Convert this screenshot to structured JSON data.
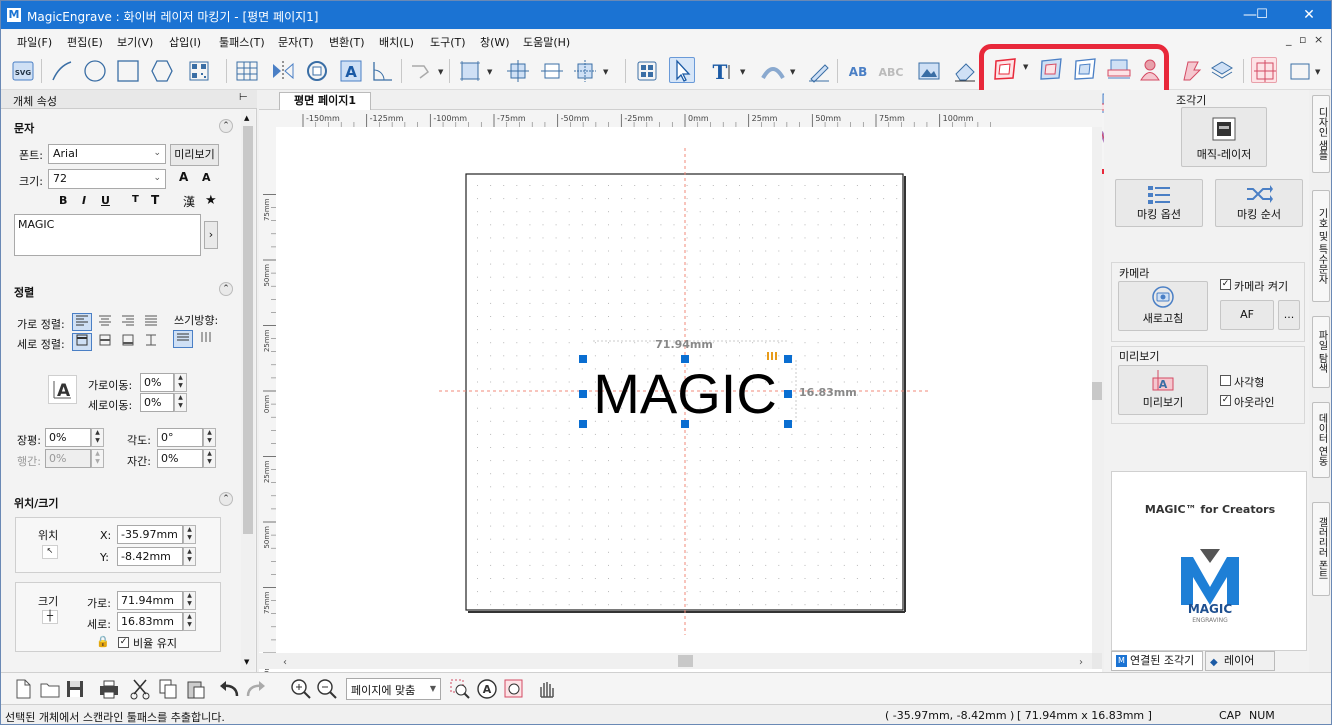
{
  "titlebar": {
    "title": "MagicEngrave : 화이버 레이저 마킹기 - [평면 페이지1]",
    "icon": "app-logo-icon",
    "min": "—",
    "max": "☐",
    "close": "✕"
  },
  "menu": [
    "파일(F)",
    "편집(E)",
    "보기(V)",
    "삽입(I)",
    "툴패스(T)",
    "문자(T)",
    "변환(T)",
    "배치(L)",
    "도구(T)",
    "창(W)",
    "도움말(H)"
  ],
  "mdi_controls": [
    "_",
    "▫",
    "×"
  ],
  "colors": {
    "accent": "#1b73d3",
    "highlight": "#e8283a",
    "selection": "#0a6ed1"
  },
  "left_panel": {
    "header": "개체 속성",
    "pin": "⊢",
    "text_section": "문자",
    "font_label": "폰트:",
    "font_value": "Arial",
    "preview_btn": "미리보기",
    "size_label": "크기:",
    "size_value": "72",
    "size_up": "A",
    "size_down": "A",
    "style_buttons": [
      "B",
      "I",
      "U",
      "T",
      "T",
      "漢",
      "★"
    ],
    "text_value": "MAGIC",
    "text_next": "›",
    "align_section": "정렬",
    "h_align_label": "가로 정렬:",
    "v_align_label": "세로 정렬:",
    "write_dir_label": "쓰기방향:",
    "h_move_label": "가로이동:",
    "h_move_value": "0%",
    "v_move_label": "세로이동:",
    "v_move_value": "0%",
    "width_ratio_label": "장평:",
    "width_ratio_value": "0%",
    "angle_label": "각도:",
    "angle_value": "0°",
    "line_gap_label": "행간:",
    "line_gap_value": "0%",
    "char_gap_label": "자간:",
    "char_gap_value": "0%",
    "pos_section": "위치/크기",
    "position_label": "위치",
    "x_label": "X:",
    "x_value": "-35.97mm",
    "y_label": "Y:",
    "y_value": "-8.42mm",
    "size2_label": "크기",
    "w_label": "가로:",
    "w_value": "71.94mm",
    "h_label": "세로:",
    "h_value": "16.83mm",
    "keep_ratio": "비율 유지"
  },
  "canvas": {
    "tab": "평면 페이지1",
    "ruler_x": [
      "-150mm",
      "-125mm",
      "-100mm",
      "-75mm",
      "-50mm",
      "-25mm",
      "0mm",
      "25mm",
      "50mm",
      "75mm",
      "100mm"
    ],
    "ruler_y": [
      "75mm",
      "50mm",
      "25mm",
      "0mm",
      "25mm",
      "50mm",
      "75mm",
      "100mm"
    ],
    "object_text": "MAGIC",
    "dim_width": "71.94mm",
    "dim_height": "16.83mm"
  },
  "right_panel": {
    "section_label": "조각기",
    "magic_laser": "매직-레이저",
    "mark_option": "마킹 옵션",
    "mark_order": "마킹 순서",
    "camera_section": "카메라",
    "camera_on": "카메라 켜기",
    "refresh": "새로고침",
    "af": "AF",
    "more": "...",
    "preview_section": "미리보기",
    "preview_btn": "미리보기",
    "rect": "사각형",
    "outline": "아웃라인",
    "ad_title": "MAGIC™ for Creators",
    "ad_logo_text": "MAGIC",
    "ad_logo_sub": "ENGRAVING",
    "tab_connected": "연결된 조각기",
    "tab_layer": "레이어"
  },
  "vtabs": [
    "디자인 샘플",
    "기호 및 특수문자",
    "파일 탐색",
    "데이터 연동",
    "갤러리러 폰트"
  ],
  "bottom": {
    "fit_label": "페이지에 맞춤"
  },
  "status": {
    "message": "선택된 개체에서 스캔라인 툴패스를 추출합니다.",
    "coords": "( -35.97mm, -8.42mm )",
    "size": "[ 71.94mm x 16.83mm ]",
    "cap": "CAP",
    "num": "NUM"
  }
}
